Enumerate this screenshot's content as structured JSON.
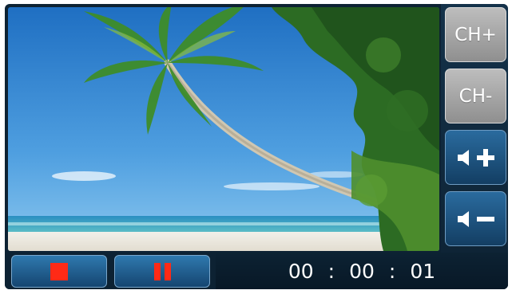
{
  "channel": {
    "up_label": "CH+",
    "down_label": "CH-"
  },
  "volume": {
    "up_icon": "volume-up-icon",
    "down_icon": "volume-down-icon",
    "plus_glyph": "+",
    "minus_glyph": "−"
  },
  "transport": {
    "stop_icon": "stop-icon",
    "pause_icon": "pause-icon",
    "stop_color": "#ff2a16",
    "button_color": "#1f5f92"
  },
  "timer": {
    "hours": "00",
    "minutes": "00",
    "seconds": "01",
    "separator": ":"
  },
  "video": {
    "content": "beach-scene-image"
  }
}
